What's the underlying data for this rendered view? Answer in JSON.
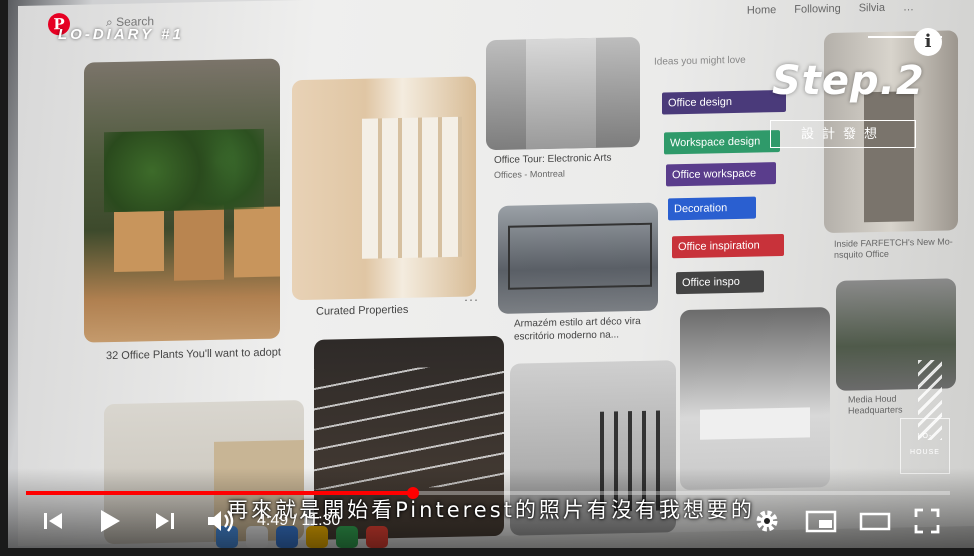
{
  "overlay": {
    "channel_tag": "LO-DIARY #1",
    "step_title": "Step.2",
    "step_subtitle": "設計發想",
    "info_glyph": "i",
    "logo_lines": [
      "LO-",
      "HOUSE"
    ],
    "subtitle": "再來就是開始看Pinterest的照片有沒有我想要的"
  },
  "pinterest": {
    "logo": "P",
    "search_placeholder": "Search",
    "nav": [
      "Home",
      "Following",
      "Silvia",
      "…"
    ],
    "side_search": "Ideas you might love",
    "captions": {
      "plants": "32 Office Plants You'll want to adopt",
      "curated": "Curated Properties",
      "office_tour_title": "Office Tour: Electronic Arts",
      "office_tour_sub": "Offices - Montreal",
      "armazem": "Armazém estilo art déco vira escritório moderno na...",
      "inside": "Inside FARFETCH's New Mo- nsquito Office",
      "media": "Media Houd Headquarters"
    },
    "tags": [
      {
        "label": "Office design",
        "color": "#4a3a7a"
      },
      {
        "label": "Workspace design",
        "color": "#2f9a6a"
      },
      {
        "label": "Office workspace",
        "color": "#5a3d8c"
      },
      {
        "label": "Decoration",
        "color": "#2a5fd0"
      },
      {
        "label": "Office inspiration",
        "color": "#c8323a"
      },
      {
        "label": "Office inspo",
        "color": "#444444"
      }
    ],
    "dots": "···"
  },
  "player": {
    "current_time": "4:49",
    "duration": "11:30",
    "time_text": "4:49 / 11:30",
    "progress": 0.419,
    "accent": "#ff0000",
    "icons": [
      "skip-previous-icon",
      "play-icon",
      "skip-next-icon",
      "volume-icon",
      "settings-icon",
      "miniplayer-icon",
      "theater-mode-icon",
      "fullscreen-icon"
    ]
  }
}
